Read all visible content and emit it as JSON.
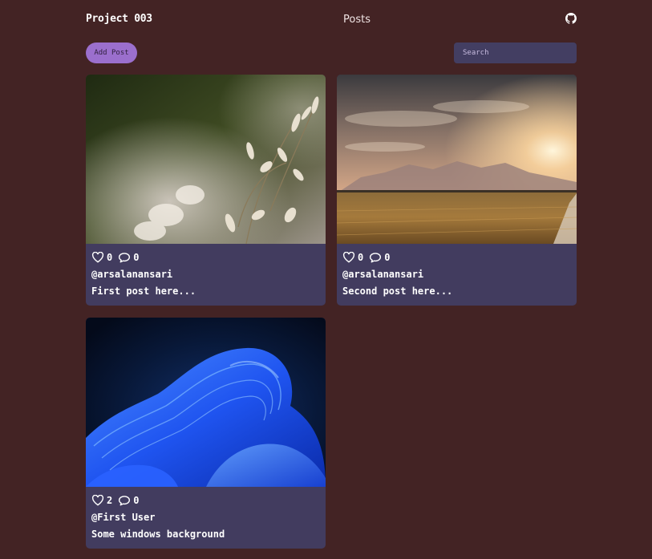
{
  "header": {
    "brand": "Project 003",
    "title": "Posts",
    "github_icon": "github-icon"
  },
  "toolbar": {
    "add_post_label": "Add Post",
    "search_placeholder": "Search"
  },
  "posts": [
    {
      "image": "wildflower-closeup-photo",
      "likes": "0",
      "comments": "0",
      "author": "@arsalanansari",
      "text": "First post here..."
    },
    {
      "image": "sunset-field-photo",
      "likes": "0",
      "comments": "0",
      "author": "@arsalanansari",
      "text": "Second post here..."
    },
    {
      "image": "blue-bloom-wallpaper",
      "likes": "2",
      "comments": "0",
      "author": "@First User",
      "text": "Some windows background"
    }
  ],
  "colors": {
    "page_background": "#432324",
    "card_background": "#423c5f",
    "accent_button": "#9b6fcd",
    "search_background": "#433e62"
  }
}
